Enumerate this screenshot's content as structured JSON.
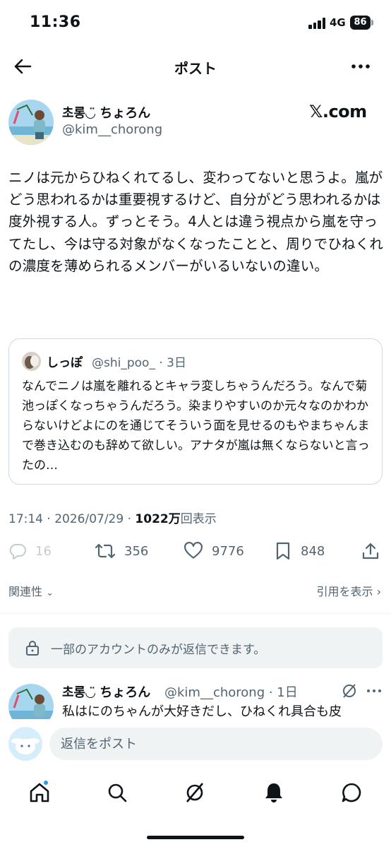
{
  "status_bar": {
    "time": "11:36",
    "network": "4G",
    "battery": "86"
  },
  "nav": {
    "title": "ポスト",
    "back_icon": "arrow-left-icon",
    "more_icon": "more-horizontal-icon"
  },
  "post": {
    "author_name": "초롱◡̈ ちょろん",
    "author_handle": "@kim__chorong",
    "source_logo": "𝕏.com",
    "text": "ニノは元からひねくれてるし、変わってないと思うよ。嵐がどう思われるかは重要視するけど、自分がどう思われるかは度外視する人。ずっとそう。4人とは違う視点から嵐を守ってたし、今は守る対象がなくなったことと、周りでひねくれの濃度を薄められるメンバーがいるいないの違い。",
    "quote": {
      "name": "しっぽ",
      "handle": "@shi_poo_ · 3日",
      "text": "なんでニノは嵐を離れるとキャラ変しちゃうんだろう。なんで菊池っぽくなっちゃうんだろう。染まりやすいのか元々なのかわからないけどよにのを通じてそういう面を見せるのもやまちゃんまで巻き込むのも辞めて欲しい。アナタが嵐は無くならないと言ったの…"
    },
    "timestamp": "17:14 · 2026/07/29 · ",
    "views_count": "1022万",
    "views_label": "回表示"
  },
  "actions": {
    "replies": "16",
    "reposts": "356",
    "likes": "9776",
    "bookmarks": "848"
  },
  "related_label": "関連性",
  "quotes_label": "引用を表示",
  "restriction_notice": "一部のアカウントのみが返信できます。",
  "reply": {
    "author_name": "초롱◡̈ ちょろん",
    "author_handle": "@kim__chorong · 1日",
    "text": "私はにのちゃんが大好きだし、ひねくれ具合も皮"
  },
  "composer": {
    "placeholder": "返信をポスト"
  },
  "colors": {
    "text": "#0f1419",
    "secondary": "#536471",
    "accent": "#1d9bf0",
    "divider": "#eff3f4"
  }
}
